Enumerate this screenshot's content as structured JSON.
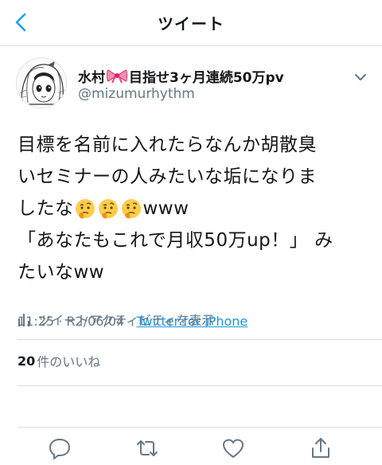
{
  "nav": {
    "title": "ツイート"
  },
  "tweet": {
    "display_name_part1": "水村",
    "display_name_part2": "目指せ3ヶ月連続50万pv",
    "handle": "@mizumurhythm",
    "lines": [
      "目標を名前に入れたらなんか胡散臭",
      "いセミナーの人みたいな垢になりま",
      "したな",
      "www",
      "「あなたもこれで月収50万up！」 み",
      "たいなww"
    ],
    "time": "11:25",
    "separator": "·",
    "date": "R2/06/04",
    "source": "Twitter for iPhone",
    "activity_label": "ツイートアクティビティを表示",
    "likes_count": "20",
    "likes_suffix": "件のいいね"
  },
  "icons": {
    "back": "chevron-left-icon",
    "more": "chevron-down-icon",
    "bow": "ribbon-emoji",
    "thinking": "thinking-face-emoji",
    "activity": "bar-chart-icon",
    "reply": "comment-icon",
    "retweet": "retweet-icon",
    "like": "heart-icon",
    "share": "share-icon"
  },
  "colors": {
    "link": "#1b95e0",
    "secondary": "#657786",
    "accent": "#1da1f2"
  }
}
